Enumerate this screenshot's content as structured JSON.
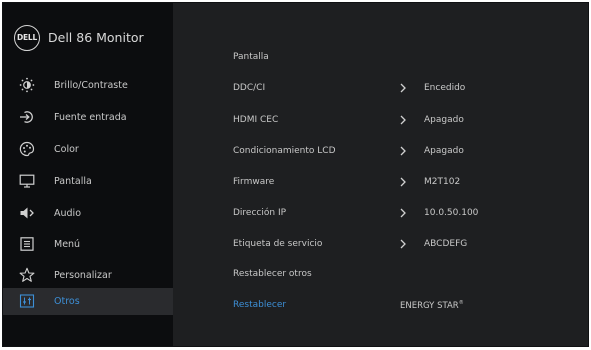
{
  "header": {
    "logo_text": "DELL",
    "model_name": "Dell 86 Monitor"
  },
  "sidebar": {
    "items": [
      {
        "label": "Brillo/Contraste",
        "icon": "brightness-icon"
      },
      {
        "label": "Fuente entrada",
        "icon": "input-source-icon"
      },
      {
        "label": "Color",
        "icon": "color-palette-icon"
      },
      {
        "label": "Pantalla",
        "icon": "display-icon"
      },
      {
        "label": "Audio",
        "icon": "speaker-icon"
      },
      {
        "label": "Menú",
        "icon": "menu-icon"
      },
      {
        "label": "Personalizar",
        "icon": "star-icon"
      },
      {
        "label": "Otros",
        "icon": "others-icon",
        "selected": true
      }
    ]
  },
  "main": {
    "items": [
      {
        "label": "Pantalla"
      },
      {
        "label": "DDC/CI",
        "value": "Encedido"
      },
      {
        "label": "HDMI CEC",
        "value": "Apagado"
      },
      {
        "label": "Condicionamiento LCD",
        "value": "Apagado"
      },
      {
        "label": "Firmware",
        "value": "M2T102"
      },
      {
        "label": "Dirección IP",
        "value": "10.0.50.100"
      },
      {
        "label": "Etiqueta de servicio",
        "value": "ABCDEFG"
      },
      {
        "label": "Restablecer otros"
      },
      {
        "label": "Restablecer",
        "highlighted": true
      }
    ],
    "energy_star": "ENERGY STAR",
    "energy_star_mark": "®"
  },
  "colors": {
    "panel": "#1e1f21",
    "sidebar": "#0c0d0f",
    "accent": "#3d8fd6",
    "text": "#c8c8c8"
  }
}
